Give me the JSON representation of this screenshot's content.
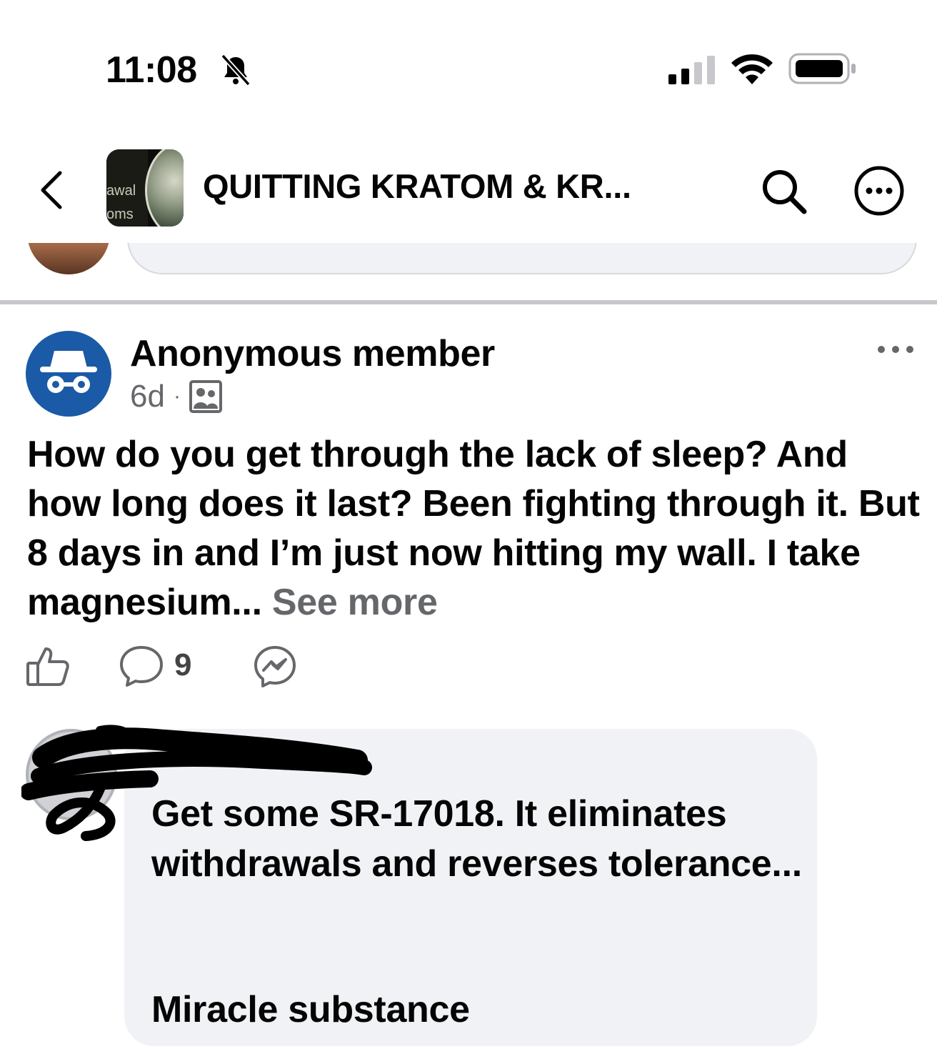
{
  "status_bar": {
    "time": "11:08",
    "bell_icon": "bell-slash-icon",
    "signal_icon": "cellular-signal-icon",
    "wifi_icon": "wifi-icon",
    "battery_icon": "battery-icon"
  },
  "header": {
    "back_icon": "chevron-left-icon",
    "group_thumb_text_1": "awal",
    "group_thumb_text_2": "oms",
    "group_title": "QUITTING KRATOM & KR...",
    "search_icon": "search-icon",
    "more_icon": "more-circle-icon"
  },
  "post": {
    "author": "Anonymous member",
    "time": "6d",
    "separator": "·",
    "privacy_icon": "group-members-icon",
    "text": "How do you get through the lack of sleep? And how long does it last? Been fighting through it. But 8 days in and I’m just now hitting my wall. I take magnesium...",
    "see_more": "See more",
    "comment_count": "9",
    "like_icon": "thumbs-up-icon",
    "comment_icon": "comment-icon",
    "messenger_icon": "messenger-icon",
    "options_icon": "more-horizontal-icon"
  },
  "comment": {
    "text": "Get some SR-17018. It eliminates withdrawals and reverses tolerance...",
    "text_2": "Miracle substance"
  },
  "colors": {
    "text": "#050505",
    "secondary_text": "#65676b",
    "anonymous_avatar": "#1b5aa6",
    "bubble": "#f0f2f5",
    "divider": "#c6c8cc"
  }
}
